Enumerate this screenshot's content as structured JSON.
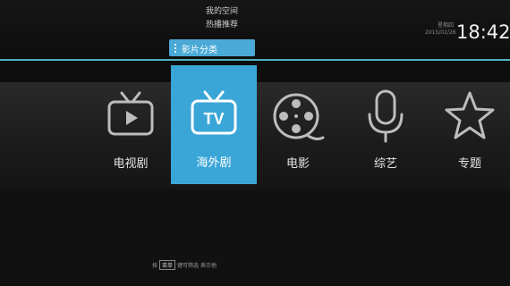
{
  "top_menu": [
    "我的空间",
    "热播推荐"
  ],
  "category_tab": "影片分类",
  "clock": {
    "time": "18:42",
    "line1": "星期四",
    "line2": "2015/02/26"
  },
  "items": [
    {
      "label": "电视剧",
      "icon": "tv-play-icon"
    },
    {
      "label": "海外剧",
      "icon": "tv-icon",
      "selected": true
    },
    {
      "label": "电影",
      "icon": "film-reel-icon"
    },
    {
      "label": "综艺",
      "icon": "microphone-icon"
    },
    {
      "label": "专题",
      "icon": "star-icon"
    }
  ],
  "hint": {
    "pre": "按",
    "key": "菜单",
    "post": "键可筛选 表示他"
  },
  "colors": {
    "accent": "#3aa6d8",
    "line": "#4fb3bf"
  }
}
